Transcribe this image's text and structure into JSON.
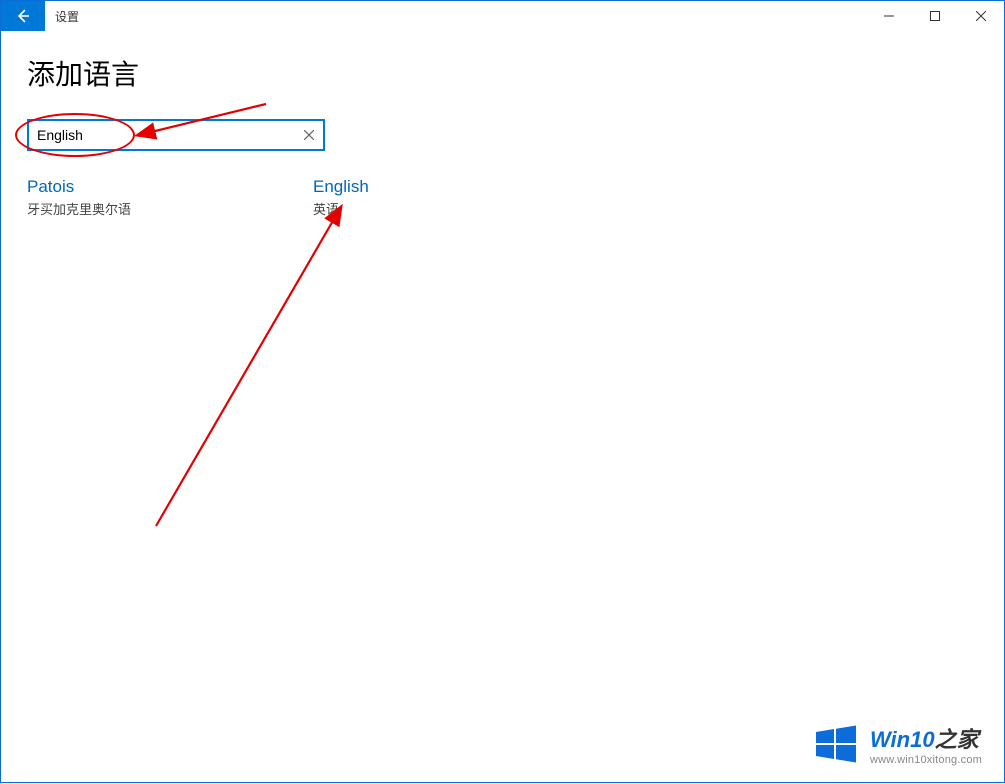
{
  "titlebar": {
    "title": "设置"
  },
  "page": {
    "heading": "添加语言"
  },
  "search": {
    "value": "English"
  },
  "results": [
    {
      "name": "Patois",
      "sub": "牙买加克里奥尔语"
    },
    {
      "name": "English",
      "sub": "英语"
    }
  ],
  "watermark": {
    "brand_prefix": "Win10",
    "brand_suffix": "之家",
    "url": "www.win10xitong.com"
  }
}
